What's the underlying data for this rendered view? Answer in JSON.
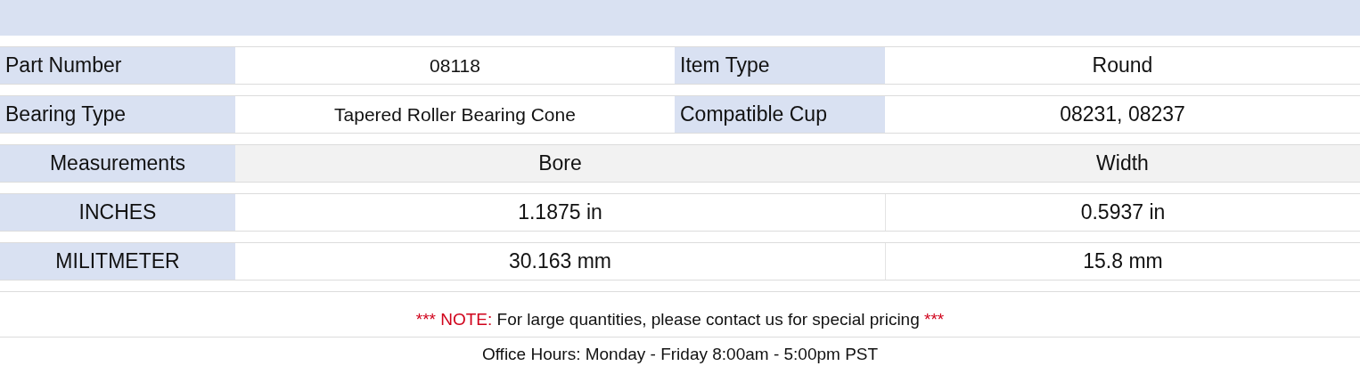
{
  "specs": [
    {
      "cells": [
        {
          "label": "Part Number",
          "value": "08118"
        },
        {
          "label": "Item Type",
          "value": "Round"
        }
      ]
    },
    {
      "cells": [
        {
          "label": "Bearing Type",
          "value": "Tapered Roller Bearing Cone"
        },
        {
          "label": "Compatible Cup",
          "value": "08231, 08237"
        }
      ]
    }
  ],
  "measurements": {
    "label": "Measurements",
    "columns": [
      "Bore",
      "Width"
    ],
    "rows": [
      {
        "unit": "INCHES",
        "values": [
          "1.1875 in",
          "0.5937 in"
        ]
      },
      {
        "unit": "MILITMETER",
        "values": [
          "30.163 mm",
          "15.8 mm"
        ]
      }
    ]
  },
  "note": {
    "prefix": "*** NOTE:",
    "text": "For large quantities, please contact us for special pricing",
    "suffix": "***"
  },
  "office_hours": "Office Hours: Monday - Friday 8:00am - 5:00pm PST"
}
